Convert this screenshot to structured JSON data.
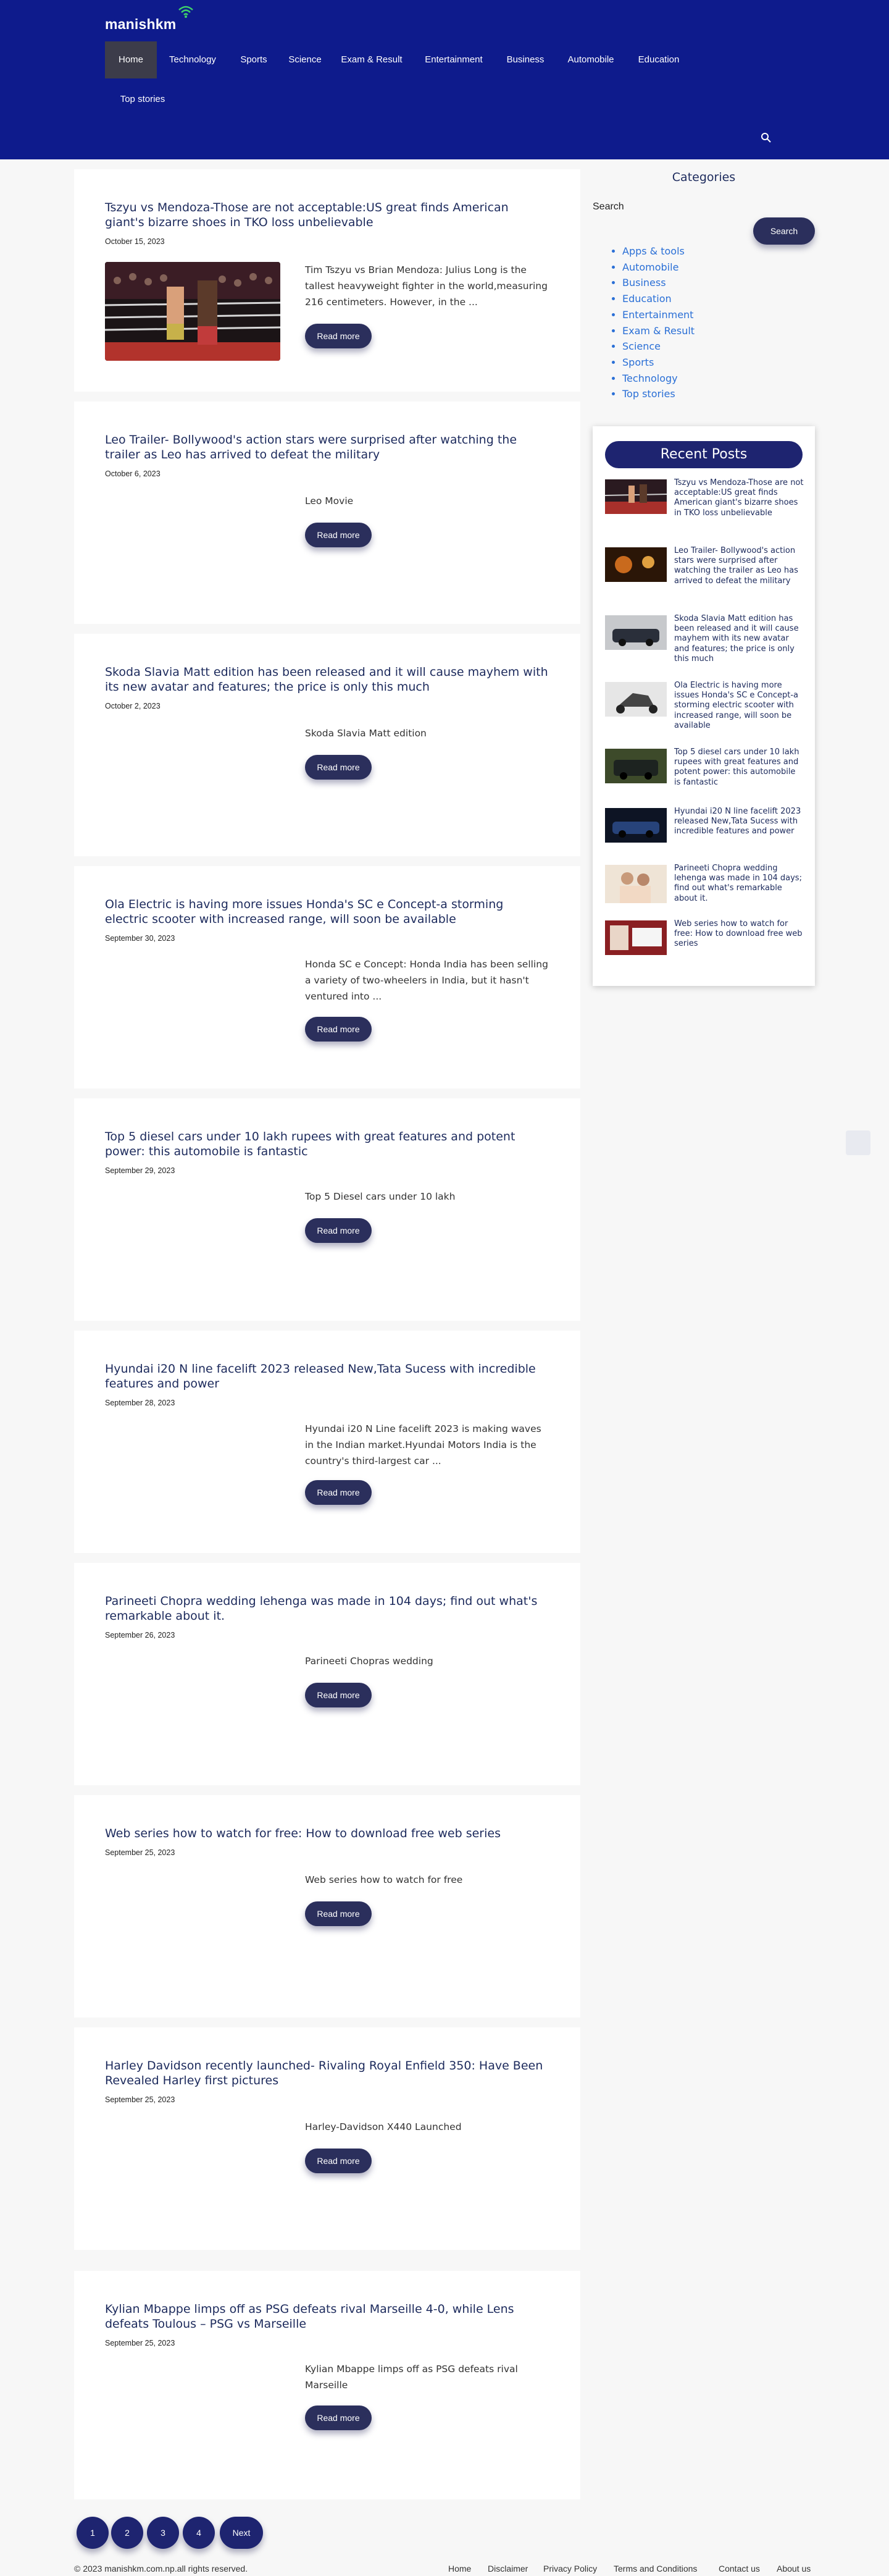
{
  "header": {
    "logo": "manishkm",
    "nav": [
      "Home",
      "Technology",
      "Sports",
      "Science",
      "Exam & Result",
      "Entertainment",
      "Business",
      "Automobile",
      "Education",
      "Top stories"
    ],
    "search_icon": "search-icon"
  },
  "posts": [
    {
      "title": "Tszyu vs Mendoza-Those are not acceptable:US great finds American giant's bizarre shoes in TKO loss unbelievable",
      "date": "October 15, 2023",
      "excerpt": "Tim Tszyu vs Brian Mendoza: Julius Long is the tallest heavyweight fighter in the world,measuring 216 centimeters. However, in the ...",
      "read_more": "Read more"
    },
    {
      "title": "Leo Trailer- Bollywood's action stars were surprised after watching the trailer as Leo has arrived to defeat the military",
      "date": "October 6, 2023",
      "excerpt": "Leo Movie",
      "read_more": "Read more"
    },
    {
      "title": "Skoda Slavia Matt edition has been released and it will cause mayhem with its new avatar and features; the price is only this much",
      "date": "October 2, 2023",
      "excerpt": "Skoda Slavia Matt edition",
      "read_more": "Read more"
    },
    {
      "title": "Ola Electric is having more issues Honda's SC e Concept-a storming electric scooter with increased range, will soon be available",
      "date": "September 30, 2023",
      "excerpt": "Honda SC e Concept: Honda India has been selling a variety of two-wheelers in India, but it hasn't ventured into ...",
      "read_more": "Read more"
    },
    {
      "title": "Top 5 diesel cars under 10 lakh rupees with great features and potent power: this automobile is fantastic",
      "date": "September 29, 2023",
      "excerpt": "Top 5 Diesel cars under 10 lakh",
      "read_more": "Read more"
    },
    {
      "title": "Hyundai i20 N line facelift 2023 released New,Tata Sucess with incredible features and power",
      "date": "September 28, 2023",
      "excerpt": "Hyundai i20 N Line facelift 2023 is making waves in the Indian market.Hyundai Motors India is the country's third-largest car ...",
      "read_more": "Read more"
    },
    {
      "title": "Parineeti Chopra wedding lehenga was made in 104 days; find out what's remarkable about it.",
      "date": "September 26, 2023",
      "excerpt": "Parineeti Chopras wedding",
      "read_more": "Read more"
    },
    {
      "title": "Web series how to watch for free: How to download free web series",
      "date": "September 25, 2023",
      "excerpt": "Web series how to watch for free",
      "read_more": "Read more"
    },
    {
      "title": "Harley Davidson recently launched- Rivaling Royal Enfield 350: Have Been Revealed Harley first pictures",
      "date": "September 25, 2023",
      "excerpt": "Harley-Davidson X440 Launched",
      "read_more": "Read more"
    },
    {
      "title": "Kylian Mbappe limps off as PSG defeats rival Marseille 4-0, while Lens defeats Toulous – PSG vs Marseille",
      "date": "September 25, 2023",
      "excerpt": "Kylian Mbappe limps off as PSG defeats rival Marseille",
      "read_more": "Read more"
    }
  ],
  "sidebar": {
    "categories_heading": "Categories",
    "search_label": "Search",
    "search_button": "Search",
    "categories": [
      "Apps & tools",
      "Automobile",
      "Business",
      "Education",
      "Entertainment",
      "Exam & Result",
      "Science",
      "Sports",
      "Technology",
      "Top stories"
    ],
    "recent_heading": "Recent Posts",
    "recent": [
      "Tszyu vs Mendoza-Those are not acceptable:US great finds American giant's bizarre shoes in TKO loss unbelievable",
      "Leo Trailer- Bollywood's action stars were surprised after watching the trailer as Leo has arrived to defeat the military",
      "Skoda Slavia Matt edition has been released and it will cause mayhem with its new avatar and features; the price is only this much",
      "Ola Electric is having more issues Honda's SC e Concept-a storming electric scooter with increased range, will soon be available",
      "Top 5 diesel cars under 10 lakh rupees with great features and potent power: this automobile is fantastic",
      "Hyundai i20 N line facelift 2023 released New,Tata Sucess with incredible features and power",
      "Parineeti Chopra wedding lehenga was made in 104 days; find out what's remarkable about it.",
      "Web series how to watch for free: How to download free web series"
    ]
  },
  "pagination": {
    "pages": [
      "1",
      "2",
      "3",
      "4"
    ],
    "next": "Next"
  },
  "footer": {
    "copyright": "© 2023 manishkm.com.np.all rights reserved.",
    "links": [
      "Home",
      "Disclaimer",
      "Privacy Policy",
      "Terms and Conditions",
      "Contact us",
      "About us"
    ]
  },
  "colors": {
    "header_bg": "#0e1b8c",
    "button": "#2b2f5c",
    "title": "#1c2a5c",
    "link": "#2a6fd6"
  }
}
